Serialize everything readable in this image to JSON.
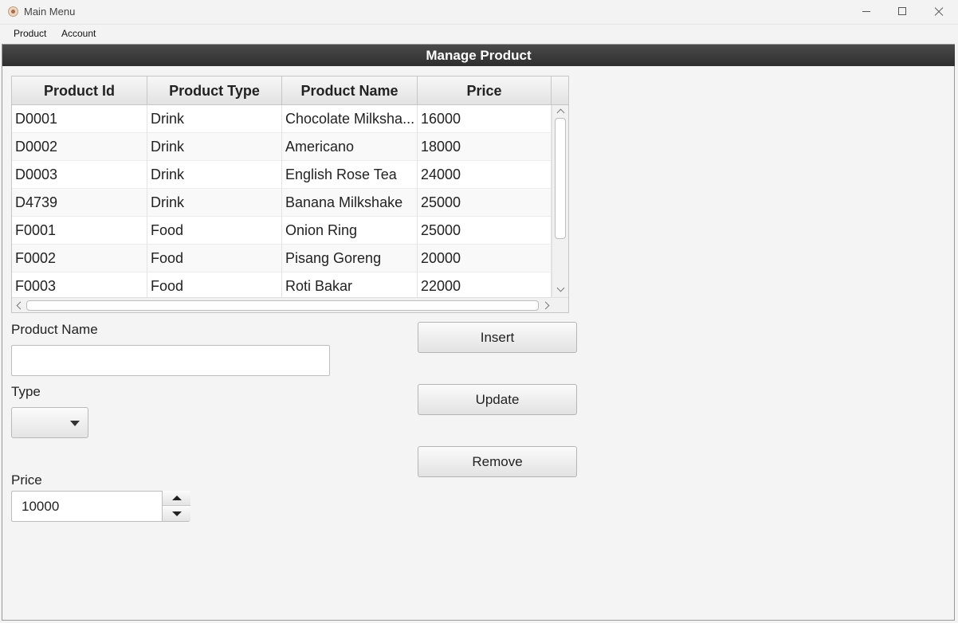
{
  "window": {
    "title": "Main Menu"
  },
  "menu": {
    "items": [
      "Product",
      "Account"
    ]
  },
  "section": {
    "title": "Manage Product"
  },
  "table": {
    "columns": [
      "Product Id",
      "Product Type",
      "Product Name",
      "Price"
    ],
    "rows": [
      [
        "D0001",
        "Drink",
        "Chocolate Milksha...",
        "16000"
      ],
      [
        "D0002",
        "Drink",
        "Americano",
        "18000"
      ],
      [
        "D0003",
        "Drink",
        "English Rose Tea",
        "24000"
      ],
      [
        "D4739",
        "Drink",
        "Banana Milkshake",
        "25000"
      ],
      [
        "F0001",
        "Food",
        "Onion Ring",
        "25000"
      ],
      [
        "F0002",
        "Food",
        "Pisang Goreng",
        "20000"
      ],
      [
        "F0003",
        "Food",
        "Roti Bakar",
        "22000"
      ]
    ]
  },
  "form": {
    "name_label": "Product Name",
    "name_value": "",
    "type_label": "Type",
    "type_value": "",
    "price_label": "Price",
    "price_value": "10000"
  },
  "buttons": {
    "insert": "Insert",
    "update": "Update",
    "remove": "Remove"
  }
}
